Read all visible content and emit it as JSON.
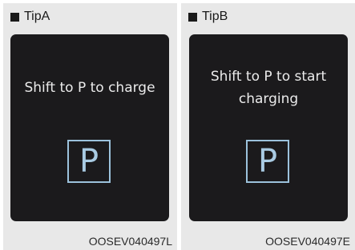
{
  "panels": [
    {
      "title": "TipA",
      "message": "Shift to P to charge",
      "gear": "P",
      "code": "OOSEV040497L"
    },
    {
      "title": "TipB",
      "message": "Shift to P to start charging",
      "gear": "P",
      "code": "OOSEV040497E"
    }
  ],
  "colors": {
    "screen_background": "#1b1a1c",
    "gear_indicator": "#9cc2dc",
    "panel_background": "#e8e8e8"
  }
}
